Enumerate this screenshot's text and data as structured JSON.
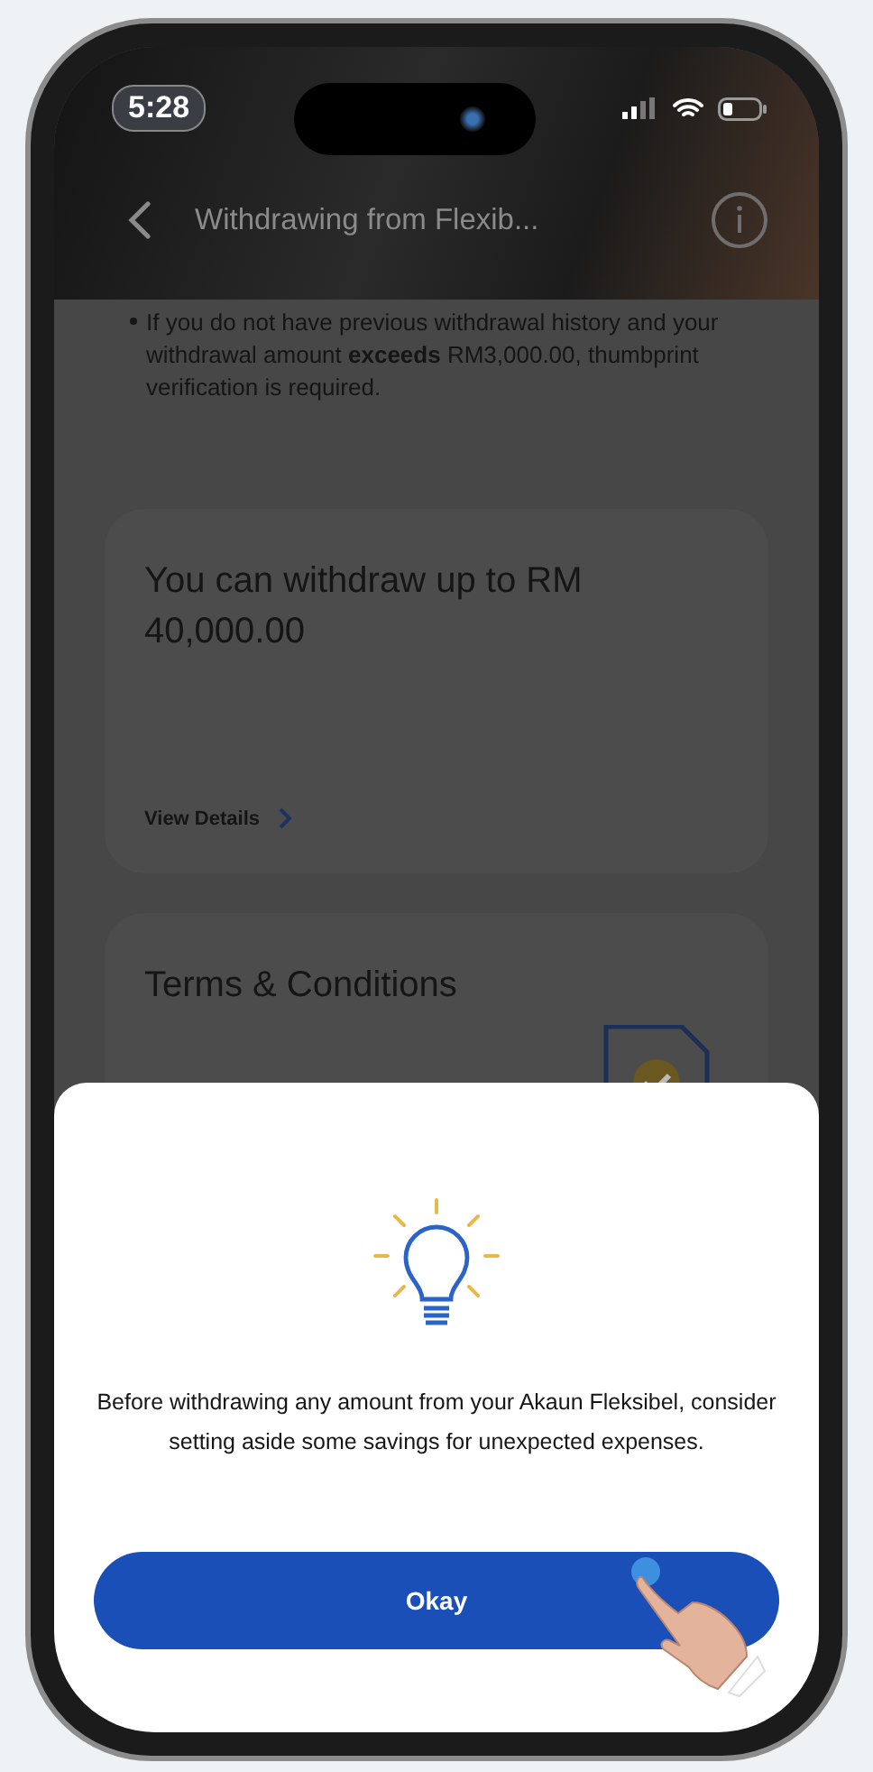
{
  "status_bar": {
    "time": "5:28"
  },
  "header": {
    "title": "Withdrawing from Flexib..."
  },
  "notice": {
    "text": "If you do not have previous withdrawal history and your withdrawal amount **exceeds** RM3,000.00, thumbprint verification is required."
  },
  "limit_card": {
    "title": "You can withdraw up to RM 40,000.00",
    "link": "View Details"
  },
  "terms_card": {
    "title": "Terms & Conditions"
  },
  "dialog": {
    "message": "Before withdrawing any amount from your Akaun Fleksibel, consider setting aside some savings for unexpected expenses.",
    "button": "Okay"
  }
}
